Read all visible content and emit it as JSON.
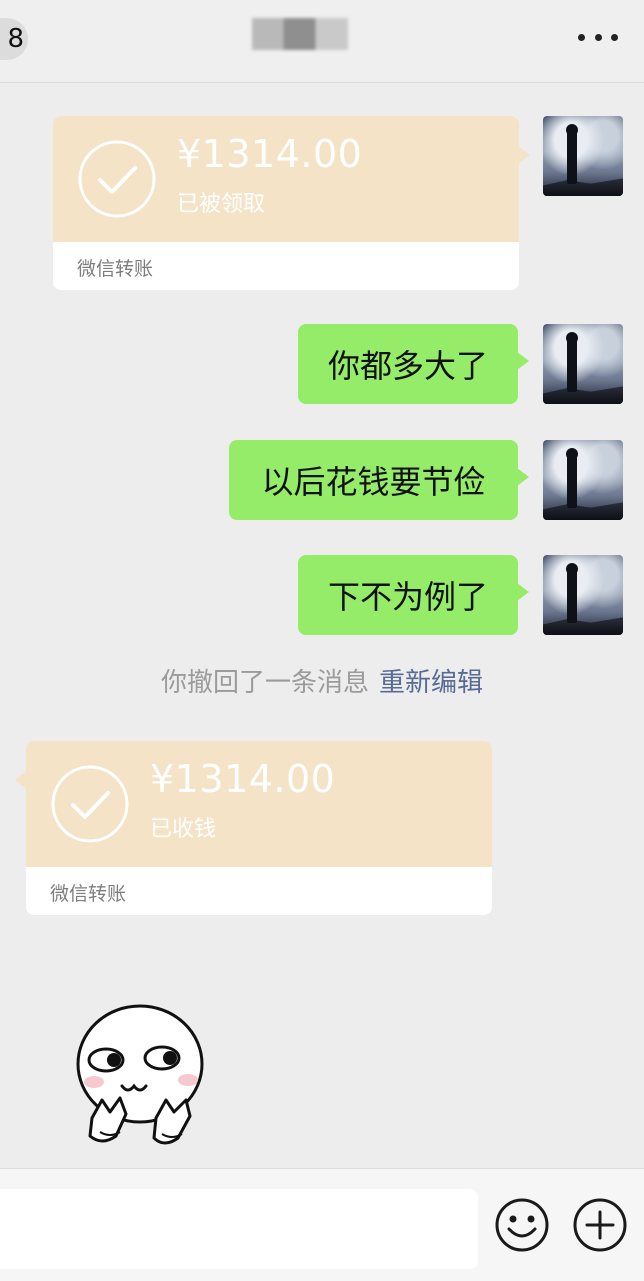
{
  "header": {
    "back_badge": "8",
    "menu_icon": "more-dots-icon"
  },
  "messages": [
    {
      "type": "transfer",
      "side": "right",
      "amount": "¥1314.00",
      "status": "已被领取",
      "footer": "微信转账"
    },
    {
      "type": "text",
      "side": "right",
      "text": "你都多大了"
    },
    {
      "type": "text",
      "side": "right",
      "text": "以后花钱要节俭"
    },
    {
      "type": "text",
      "side": "right",
      "text": "下不为例了"
    },
    {
      "type": "system",
      "text": "你撤回了一条消息",
      "action": "重新编辑"
    },
    {
      "type": "transfer",
      "side": "left",
      "amount": "¥1314.00",
      "status": "已收钱",
      "footer": "微信转账"
    },
    {
      "type": "sticker",
      "icon": "cute-face-sticker"
    }
  ],
  "input_bar": {
    "value": "",
    "emoji_icon": "emoji-icon",
    "plus_icon": "plus-circle-icon"
  },
  "colors": {
    "self_bubble": "#95ec69",
    "transfer_bg": "#f4e3c7",
    "link": "#576b95",
    "chat_bg": "#ededed"
  }
}
